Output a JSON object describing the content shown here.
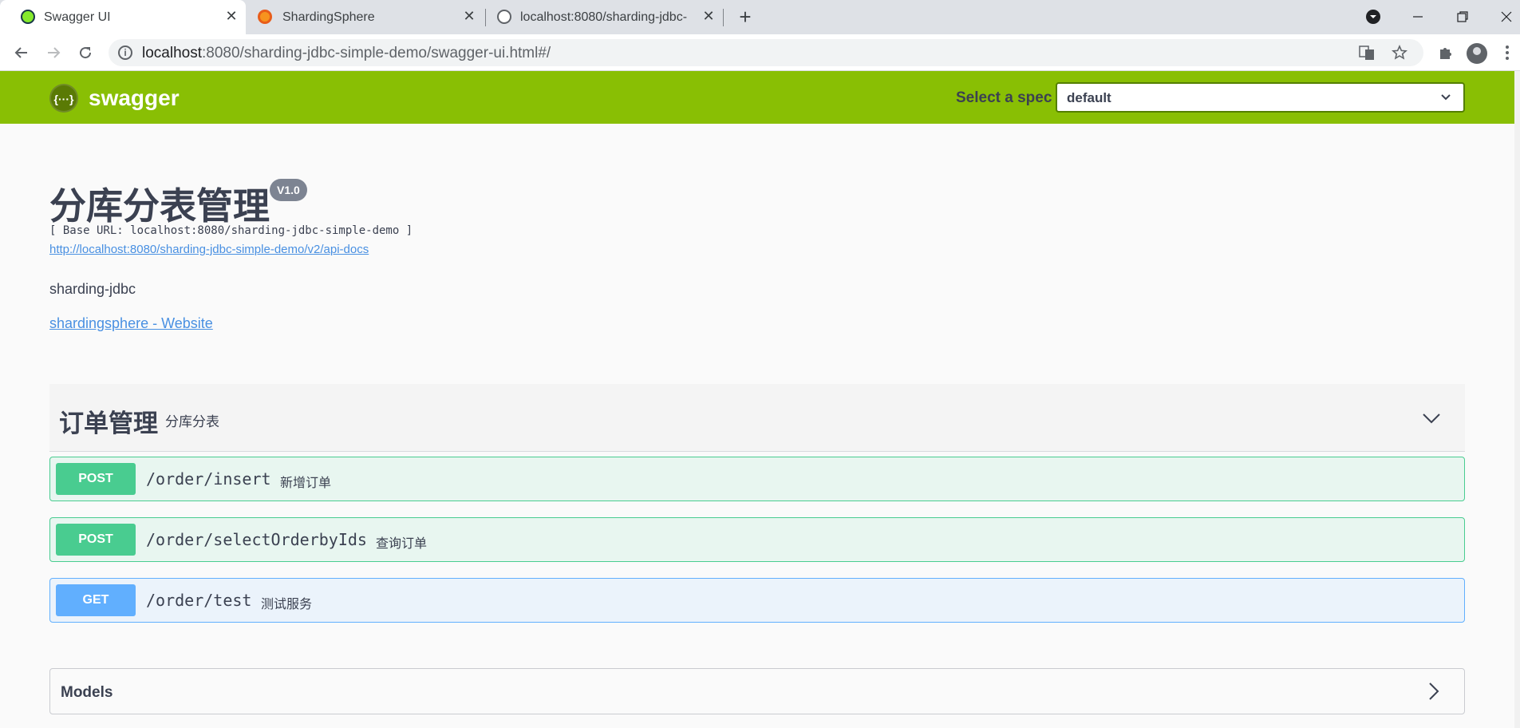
{
  "browser": {
    "tabs": [
      {
        "title": "Swagger UI",
        "active": true
      },
      {
        "title": "ShardingSphere",
        "active": false
      },
      {
        "title": "localhost:8080/sharding-jdbc-",
        "active": false
      }
    ],
    "close_glyph": "✕",
    "new_tab_glyph": "+",
    "url_host": "localhost",
    "url_path": ":8080/sharding-jdbc-simple-demo/swagger-ui.html#/"
  },
  "swagger": {
    "brand": "swagger",
    "logo_glyph": "{···}",
    "spec_label": "Select a spec",
    "spec_value": "default"
  },
  "info": {
    "title": "分库分表管理",
    "version": "V1.0",
    "base_url": "[ Base URL: localhost:8080/sharding-jdbc-simple-demo ]",
    "api_docs_url": "http://localhost:8080/sharding-jdbc-simple-demo/v2/api-docs",
    "description": "sharding-jdbc",
    "website_link": "shardingsphere - Website"
  },
  "tag": {
    "name": "订单管理",
    "description": "分库分表"
  },
  "operations": [
    {
      "method": "POST",
      "path": "/order/insert",
      "summary": "新增订单"
    },
    {
      "method": "POST",
      "path": "/order/selectOrderbyIds",
      "summary": "查询订单"
    },
    {
      "method": "GET",
      "path": "/order/test",
      "summary": "测试服务"
    }
  ],
  "models": {
    "title": "Models"
  },
  "colors": {
    "topbar": "#89bf04",
    "post": "#49cc90",
    "get": "#61affe",
    "link": "#4990e2",
    "text": "#3b4151"
  }
}
